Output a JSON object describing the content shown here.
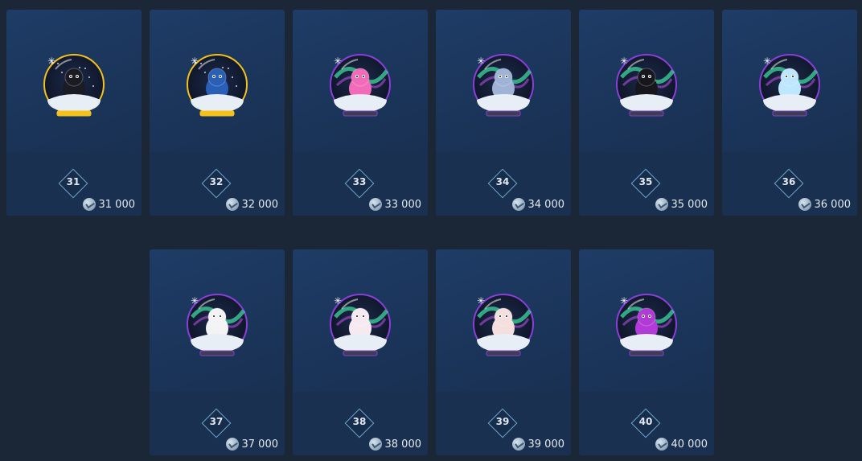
{
  "colors": {
    "page_bg": "#1b2637",
    "card_bg": "#1a3357",
    "badge_border": "#6fa6cf",
    "gold_ring": "#f4c21a",
    "purple_ring": "#8a3fd8",
    "aurora_green": "#3fd6a0"
  },
  "items": [
    {
      "level": "31",
      "price": "31 000",
      "creature": "black-bear",
      "ring": "gold",
      "aurora": false,
      "accent": "#1b1b24"
    },
    {
      "level": "32",
      "price": "32 000",
      "creature": "wizard-gnome",
      "ring": "gold",
      "aurora": false,
      "accent": "#2a5fb8"
    },
    {
      "level": "33",
      "price": "33 000",
      "creature": "pink-bunny",
      "ring": "purple",
      "aurora": true,
      "accent": "#f26bb8"
    },
    {
      "level": "34",
      "price": "34 000",
      "creature": "raccoon-dog",
      "ring": "purple",
      "aurora": true,
      "accent": "#9fb3d6"
    },
    {
      "level": "35",
      "price": "35 000",
      "creature": "penguin",
      "ring": "purple",
      "aurora": true,
      "accent": "#16161c"
    },
    {
      "level": "36",
      "price": "36 000",
      "creature": "white-reindeer",
      "ring": "purple",
      "aurora": true,
      "accent": "#bfe6ff"
    },
    {
      "level": "37",
      "price": "37 000",
      "creature": "snowy-owl",
      "ring": "purple",
      "aurora": true,
      "accent": "#f3f3f6"
    },
    {
      "level": "38",
      "price": "38 000",
      "creature": "white-fox",
      "ring": "purple",
      "aurora": true,
      "accent": "#f7e9f0"
    },
    {
      "level": "39",
      "price": "39 000",
      "creature": "polar-bear",
      "ring": "purple",
      "aurora": true,
      "accent": "#f4dede"
    },
    {
      "level": "40",
      "price": "40 000",
      "creature": "purple-gnome",
      "ring": "purple",
      "aurora": true,
      "accent": "#b23ad6"
    }
  ]
}
